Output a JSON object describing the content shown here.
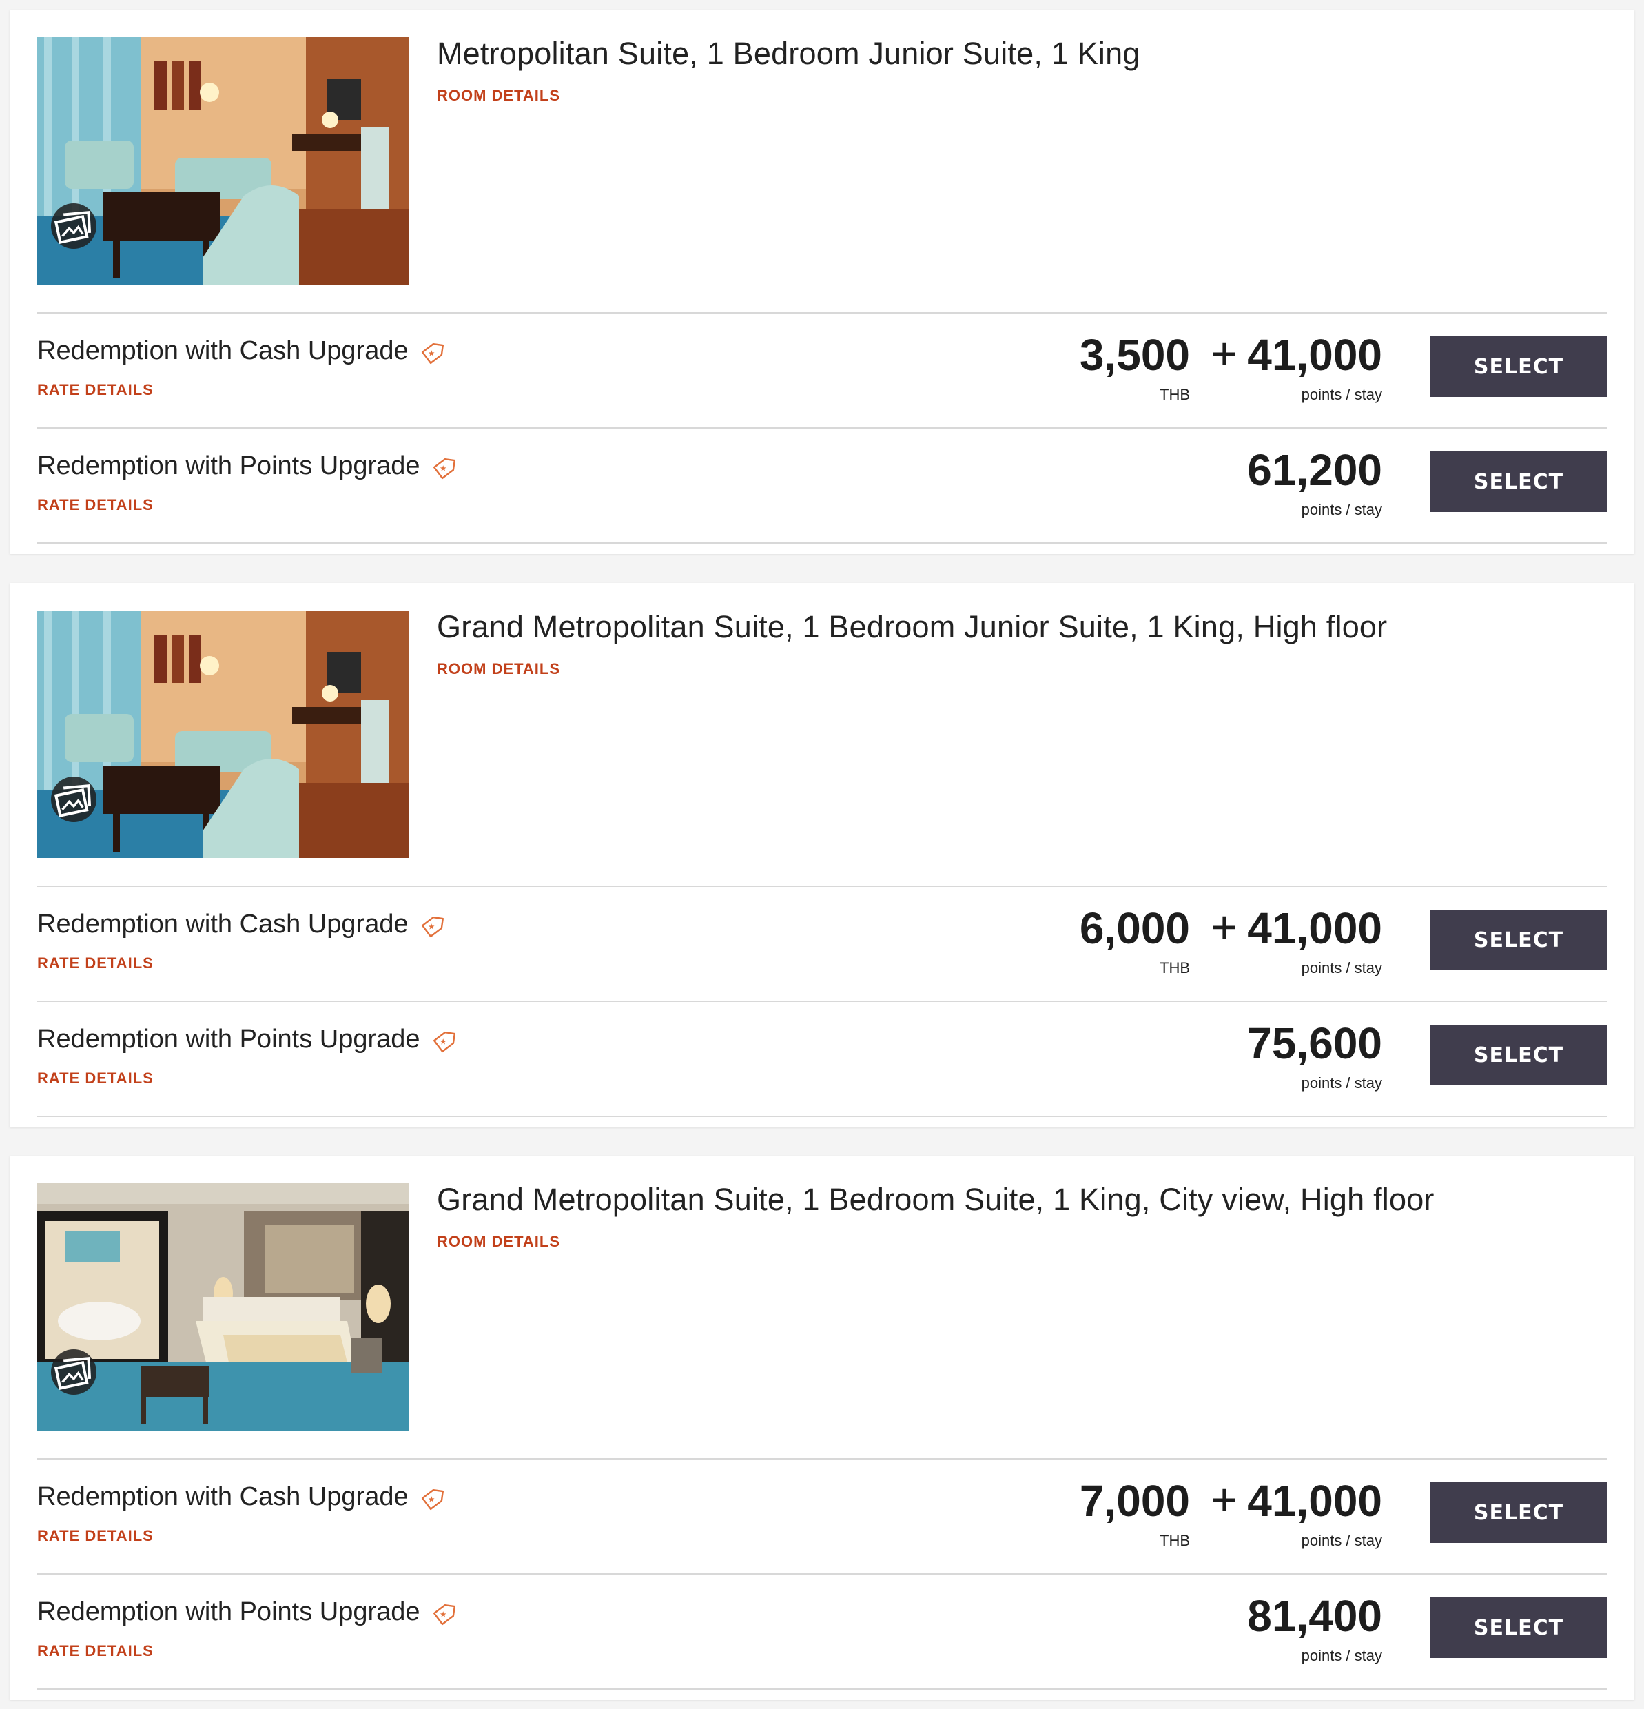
{
  "colors": {
    "accent_link": "#c2401a",
    "tag_icon": "#e2703a",
    "select_button_bg": "#403d4d",
    "select_button_text": "#ffffff",
    "page_bg": "#f4f4f4"
  },
  "rooms": [
    {
      "title": "Metropolitan Suite, 1 Bedroom Junior Suite, 1 King",
      "room_details_label": "ROOM DETAILS",
      "photo": "living-room-photo",
      "gallery_icon": "gallery-icon",
      "rates": [
        {
          "name": "Redemption with Cash Upgrade",
          "details_label": "RATE DETAILS",
          "tag_icon": "tag-icon",
          "cash": "3,500",
          "cash_unit": "THB",
          "plus": "+",
          "points": "41,000",
          "points_unit": "points / stay",
          "button": "SELECT"
        },
        {
          "name": "Redemption with Points Upgrade",
          "details_label": "RATE DETAILS",
          "tag_icon": "tag-icon",
          "points": "61,200",
          "points_unit": "points / stay",
          "button": "SELECT"
        }
      ]
    },
    {
      "title": "Grand Metropolitan Suite, 1 Bedroom Junior Suite, 1 King, High floor",
      "room_details_label": "ROOM DETAILS",
      "photo": "living-room-photo",
      "gallery_icon": "gallery-icon",
      "rates": [
        {
          "name": "Redemption with Cash Upgrade",
          "details_label": "RATE DETAILS",
          "tag_icon": "tag-icon",
          "cash": "6,000",
          "cash_unit": "THB",
          "plus": "+",
          "points": "41,000",
          "points_unit": "points / stay",
          "button": "SELECT"
        },
        {
          "name": "Redemption with Points Upgrade",
          "details_label": "RATE DETAILS",
          "tag_icon": "tag-icon",
          "points": "75,600",
          "points_unit": "points / stay",
          "button": "SELECT"
        }
      ]
    },
    {
      "title": "Grand Metropolitan Suite, 1 Bedroom Suite, 1 King, City view, High floor",
      "room_details_label": "ROOM DETAILS",
      "photo": "bedroom-photo",
      "gallery_icon": "gallery-icon",
      "rates": [
        {
          "name": "Redemption with Cash Upgrade",
          "details_label": "RATE DETAILS",
          "tag_icon": "tag-icon",
          "cash": "7,000",
          "cash_unit": "THB",
          "plus": "+",
          "points": "41,000",
          "points_unit": "points / stay",
          "button": "SELECT"
        },
        {
          "name": "Redemption with Points Upgrade",
          "details_label": "RATE DETAILS",
          "tag_icon": "tag-icon",
          "points": "81,400",
          "points_unit": "points / stay",
          "button": "SELECT"
        }
      ]
    }
  ]
}
